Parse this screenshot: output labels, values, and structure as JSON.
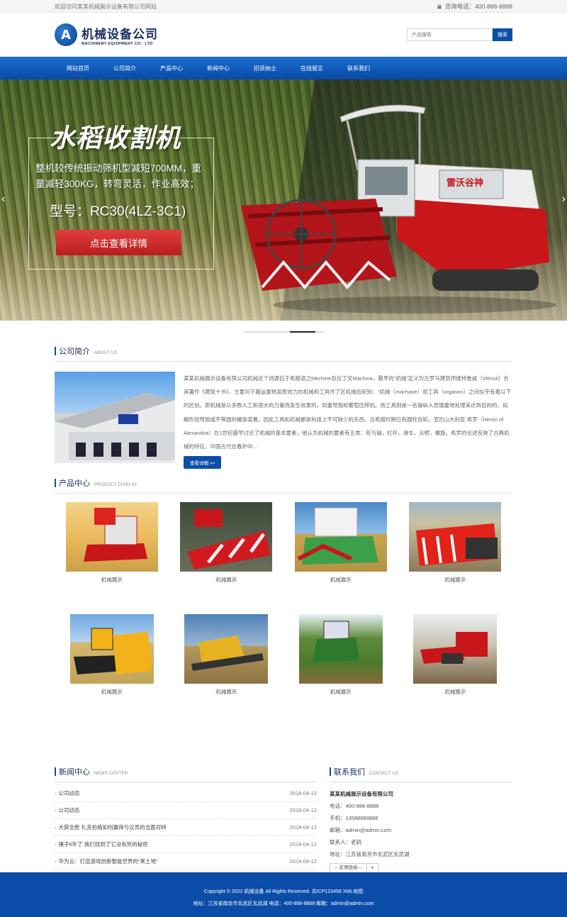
{
  "topbar": {
    "welcome": "欢迎访问某某机械展示设备有限公司网站",
    "phone": "咨询电话：400-888-8888"
  },
  "header": {
    "logo_letter": "A",
    "logo_cn": "机械设备公司",
    "logo_en": "MACHINERY EQUIPMENT CO.· LTD",
    "search_placeholder": "产品搜索",
    "search_button": "搜索"
  },
  "nav": [
    "网站首页",
    "公司简介",
    "产品中心",
    "新闻中心",
    "招贤纳士",
    "在线留言",
    "联系我们"
  ],
  "banner": {
    "title": "水稻收割机",
    "desc": "整机较传统振动筛机型减短700MM，重量减轻300KG，转弯灵活，作业高效；",
    "model": "型号：RC30(4LZ-3C1)",
    "button": "点击查看详情",
    "machine_brand": "雷沃谷神"
  },
  "about": {
    "cn": "公司简介",
    "en": "ABOUT US",
    "text": "某某机械展示设备有限公司机械这个词源自于希腊语之Mechine及拉丁文Machina，最早的“机械”定义为古罗马建筑师维特鲁威（Vitruvii）在其著作《建筑十书》，主要对于搬运重物发挥效力的机械和工具作了区机械齿轮别：“机械（machane）和工具（organon）之间似乎有着以下的区别。即机械是以多数人工和很大的力量而发生效果的，如重弩炮和葡萄压榨机。而工具则是一名操纵人员慎重地处理来达到目的的，如蝎形轻弩炮或不等圆的螺旋装置。因此工具和机械都是利用上不可缺少的东西。古希腊时期已有圆柱齿轮。亚历山大利亚·希罗（Heron of Alexandria）在1世纪最早讨论了机械的基本要素，他认为机械的要素有五类：轮与轴，杠杆，滑车，尖劈，螺旋。希罗的论述反映了古典机械的特征。中国古代在春炉中...",
    "more": "查看详细 >>"
  },
  "products": {
    "cn": "产品中心",
    "en": "PRODUCT DISPLAY",
    "items": [
      "机械展示",
      "机械展示",
      "机械展示",
      "机械展示",
      "机械展示",
      "机械展示",
      "机械展示",
      "机械展示"
    ]
  },
  "news": {
    "cn": "新闻中心",
    "en": "NEWS CENTER",
    "items": [
      {
        "title": "公司动态",
        "date": "2018-04-12"
      },
      {
        "title": "公司动态",
        "date": "2018-04-12"
      },
      {
        "title": "大获全胜 扎克伯格如何赢得与议员的当面对峙",
        "date": "2018-04-12"
      },
      {
        "title": "锤子6年了 我们找到了它没有死的秘密",
        "date": "2018-04-12"
      },
      {
        "title": "华为云：打造游戏创新智能世界的“黑土地”",
        "date": "2018-04-12"
      }
    ]
  },
  "contact": {
    "cn": "联系我们",
    "en": "CONTACT US",
    "company": "某某机械展示设备有限公司",
    "tel": "电话：400-888-8888",
    "mobile": "手机：13588888888",
    "email": "邮箱：admin@admin.com",
    "person": "联系人：老鸫",
    "address": "地址：江苏省南京市玄武区玄武湖",
    "links": "---友情链接---"
  },
  "footer": {
    "line1": "Copyright © 2022 机械设备 All Rights Reserved. 苏ICP123456 XML地图",
    "line2": "地址：江苏省南京市玄武区玄武湖  电话：400-888-8888  邮箱：admin@admin.com"
  },
  "colors": {
    "primary": "#0d4fa8",
    "nav": "#1a6dd0",
    "button_red": "#d22f2f"
  }
}
